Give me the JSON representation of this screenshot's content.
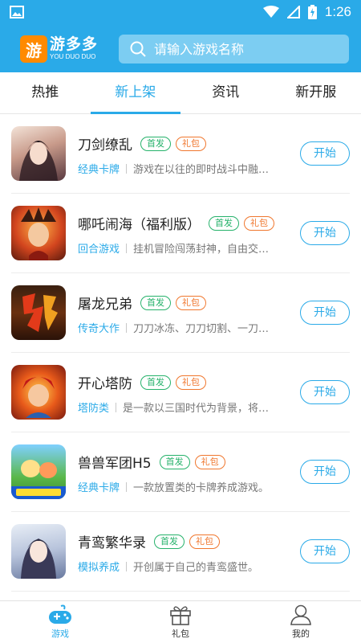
{
  "status": {
    "time": "1:26"
  },
  "app": {
    "logo_char": "游",
    "name": "游多多",
    "name_en": "YOU DUO DUO"
  },
  "search": {
    "placeholder": "请输入游戏名称"
  },
  "tabs": [
    {
      "label": "热推"
    },
    {
      "label": "新上架"
    },
    {
      "label": "资讯"
    },
    {
      "label": "新开服"
    }
  ],
  "active_tab": "新上架",
  "games": [
    {
      "name": "刀剑缭乱",
      "tag_first": "首发",
      "tag_gift": "礼包",
      "category": "经典卡牌",
      "desc": "游戏在以往的即时战斗中融…",
      "button": "开始"
    },
    {
      "name": "哪吒闹海（福利版）",
      "tag_first": "首发",
      "tag_gift": "礼包",
      "category": "回合游戏",
      "desc": "挂机冒险闯荡封神，自由交…",
      "button": "开始"
    },
    {
      "name": "屠龙兄弟",
      "tag_first": "首发",
      "tag_gift": "礼包",
      "category": "传奇大作",
      "desc": "刀刀冰冻、刀刀切割、一刀…",
      "button": "开始"
    },
    {
      "name": "开心塔防",
      "tag_first": "首发",
      "tag_gift": "礼包",
      "category": "塔防类",
      "desc": "是一款以三国时代为背景，将…",
      "button": "开始"
    },
    {
      "name": "兽兽军团H5",
      "tag_first": "首发",
      "tag_gift": "礼包",
      "category": "经典卡牌",
      "desc": "一款放置类的卡牌养成游戏。",
      "button": "开始"
    },
    {
      "name": "青鸾繁华录",
      "tag_first": "首发",
      "tag_gift": "礼包",
      "category": "模拟养成",
      "desc": "开创属于自己的青鸾盛世。",
      "button": "开始"
    }
  ],
  "bottom_nav": [
    {
      "label": "游戏"
    },
    {
      "label": "礼包"
    },
    {
      "label": "我的"
    }
  ],
  "colors": {
    "accent": "#2aaae8",
    "tag_first": "#26b26b",
    "tag_gift": "#f0772e"
  }
}
